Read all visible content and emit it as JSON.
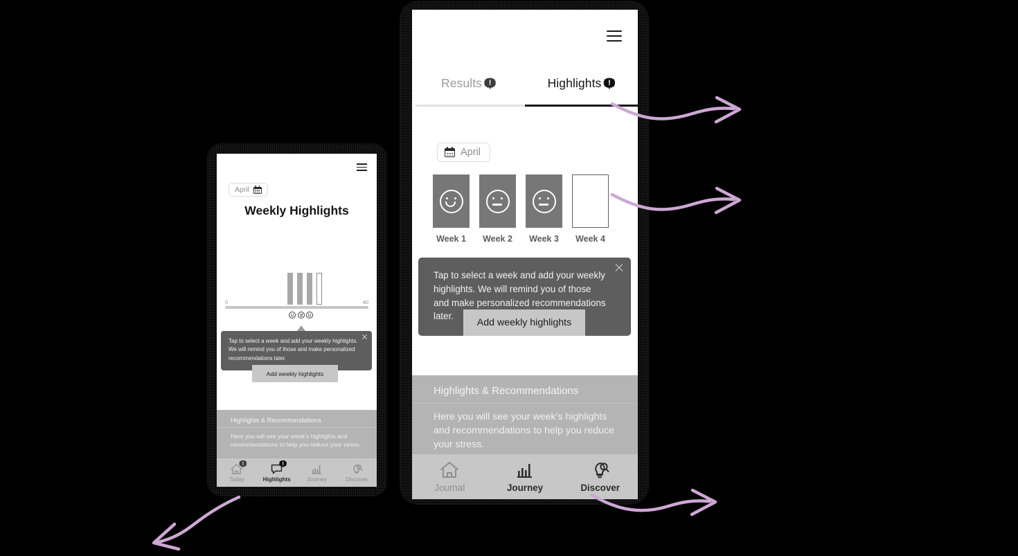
{
  "colors": {
    "accent_arrow": "#cda8d3",
    "frame": "#0a0a0a",
    "card_filled": "#777777",
    "band": "#b4b4b4",
    "nav_bg": "#c7c7c7",
    "tooltip_bg": "#5e5e5e",
    "tab_active": "#141414",
    "tab_inactive": "#9b9b9b"
  },
  "big_phone": {
    "menu_icon": "hamburger-icon",
    "tabs": [
      {
        "label": "Results",
        "active": false,
        "badge": "alert-badge-icon"
      },
      {
        "label": "Highlights",
        "active": true,
        "badge": "alert-badge-icon"
      }
    ],
    "month_selector": {
      "label": "April",
      "icon": "calendar-icon"
    },
    "weeks": [
      {
        "label": "Week 1",
        "mood": "happy",
        "filled": true
      },
      {
        "label": "Week 2",
        "mood": "neutral",
        "filled": true
      },
      {
        "label": "Week 3",
        "mood": "neutral",
        "filled": true
      },
      {
        "label": "Week 4",
        "mood": "none",
        "filled": false
      }
    ],
    "tooltip": {
      "text": "Tap to select a week and add your weekly highlights. We will remind you of those and make personalized recommendations later.",
      "close_icon": "close-icon"
    },
    "add_button": {
      "label": "Add weekly highlights"
    },
    "recommendations": {
      "title": "Highlights & Recommendations",
      "body": "Here you will see your week's highlights and recommendations to help you reduce your stress."
    },
    "bottom_nav": [
      {
        "label": "Journal",
        "icon": "home-icon",
        "active": false
      },
      {
        "label": "Journey",
        "icon": "bar-chart-icon",
        "active": true
      },
      {
        "label": "Discover",
        "icon": "lightbulb-search-icon",
        "active": true
      }
    ]
  },
  "small_phone": {
    "menu_icon": "hamburger-icon",
    "month_selector": {
      "label": "April",
      "icon": "calendar-icon"
    },
    "page_title": "Weekly Highlights",
    "chart": {
      "axis_min": "0",
      "axis_max": "40",
      "bars": [
        {
          "filled": true
        },
        {
          "filled": true
        },
        {
          "filled": true
        },
        {
          "filled": false
        }
      ],
      "faces": [
        "happy",
        "neutral",
        "neutral"
      ],
      "pointer": "triangle-pointer-icon"
    },
    "tooltip": {
      "text": "Tap to select a week and add your weekly highlights. We will remind you of those and make personalized recommendations later.",
      "close_icon": "close-icon"
    },
    "add_button": {
      "label": "Add weekly highlights"
    },
    "recommendations": {
      "title": "Highlights & Recommendations",
      "body": "Here you will see your week's highlights and recommendations to help you reduce your stress."
    },
    "bottom_nav": [
      {
        "label": "Today",
        "icon": "home-icon",
        "active": false,
        "badge": "alert-badge-icon"
      },
      {
        "label": "Highlights",
        "icon": "speech-bubble-icon",
        "active": true,
        "badge": "alert-badge-icon"
      },
      {
        "label": "Journey",
        "icon": "bar-chart-icon",
        "active": false,
        "badge": null
      },
      {
        "label": "Discover",
        "icon": "lightbulb-search-icon",
        "active": false,
        "badge": null
      }
    ]
  },
  "annotations": {
    "arrows": [
      {
        "name": "arrow-top-right",
        "direction": "right"
      },
      {
        "name": "arrow-middle-right",
        "direction": "right"
      },
      {
        "name": "arrow-bottom-right",
        "direction": "right"
      },
      {
        "name": "arrow-bottom-left",
        "direction": "left"
      }
    ]
  }
}
